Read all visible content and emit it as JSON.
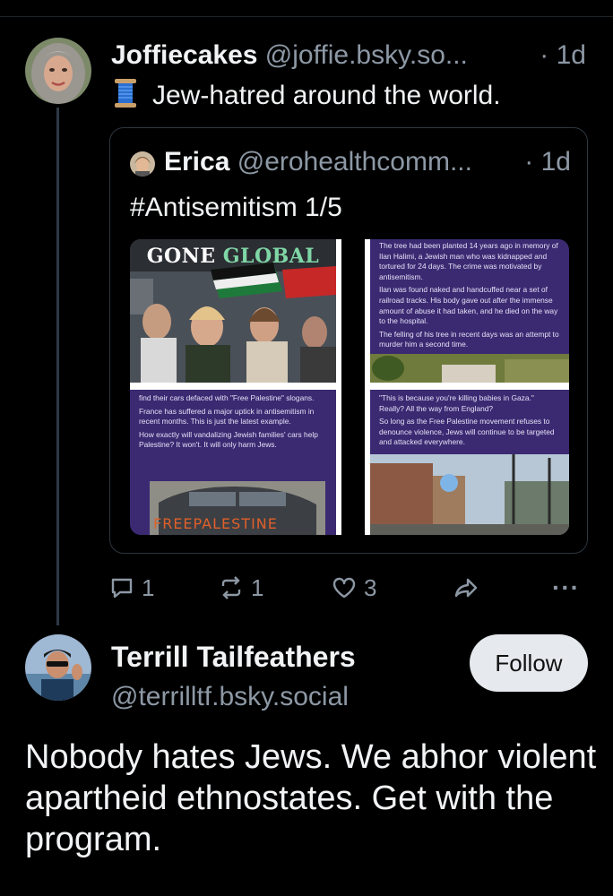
{
  "parent_post": {
    "display_name": "Joffiecakes",
    "handle": "@joffie.bsky.so...",
    "time": "· 1d",
    "text": "Jew-hatred around the world.",
    "emoji_icon": "spool-of-thread-icon"
  },
  "quote": {
    "display_name": "Erica",
    "handle": "@erohealthcomm...",
    "time": "· 1d",
    "text": "#Antisemitism 1/5",
    "images": {
      "tile1_title_part1": "GONE",
      "tile1_title_part2": "GLOBAL",
      "tile2_p1": "The tree had been planted 14 years ago in memory of Ilan Halimi, a Jewish man who was kidnapped and tortured for 24 days. The crime was motivated by antisemitism.",
      "tile2_p2": "Ilan was found naked and handcuffed near a set of railroad tracks. His body gave out after the immense amount of abuse it had taken, and he died on the way to the hospital.",
      "tile2_p3": "The felling of his tree in recent days was an attempt to murder him a second time.",
      "tile3_p1": "find their cars defaced with \"Free Palestine\" slogans.",
      "tile3_p2": "France has suffered a major uptick in antisemitism in recent months. This is just the latest example.",
      "tile3_p3": "How exactly will vandalizing Jewish families' cars help Palestine? It won't. It will only harm Jews.",
      "tile3_graffiti": "FREEPALESTINE",
      "tile4_p1": "\"This is because you're killing babies in Gaza.\" Really? All the way from England?",
      "tile4_p2": "So long as the Free Palestine movement refuses to denounce violence, Jews will continue to be targeted and attacked everywhere."
    }
  },
  "actions": {
    "reply_count": "1",
    "repost_count": "1",
    "like_count": "3",
    "more": "···"
  },
  "reply": {
    "display_name": "Terrill Tailfeathers",
    "handle": "@terrilltf.bsky.social",
    "follow_label": "Follow",
    "text": "Nobody hates Jews. We abhor violent apartheid ethnostates. Get with the program."
  },
  "colors": {
    "background": "#000000",
    "text_primary": "#f1f3f5",
    "text_secondary": "#8d98a5",
    "thread_line": "#2e3944",
    "card_border": "#2e3640",
    "follow_button_bg": "#e6eaee",
    "infographic_purple": "#3b2a72"
  }
}
